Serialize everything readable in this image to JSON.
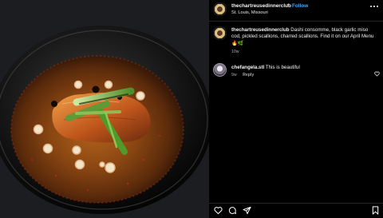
{
  "post": {
    "username": "thechartreusedinnerclub",
    "separator": "•",
    "follow_label": "Follow",
    "location": "St. Louis, Missouri"
  },
  "caption": {
    "username": "thechartreusedinnerclub",
    "text": "Dashi consomme, black garlic miso cod, pickled scallions, charred scallions. Find it on our April Menu 🔥🌿",
    "time": "10w"
  },
  "comment": {
    "username": "chefangela.stl",
    "text": "This is beautiful",
    "time": "9w",
    "reply_label": "Reply"
  },
  "icons": {
    "more": "more-options-icon",
    "like": "heart-icon",
    "comment": "comment-icon",
    "share": "share-icon",
    "save": "bookmark-icon"
  },
  "colors": {
    "background": "#000000",
    "follow": "#4aa6f5",
    "muted_text": "#a8a8a8",
    "divider": "#262626"
  }
}
